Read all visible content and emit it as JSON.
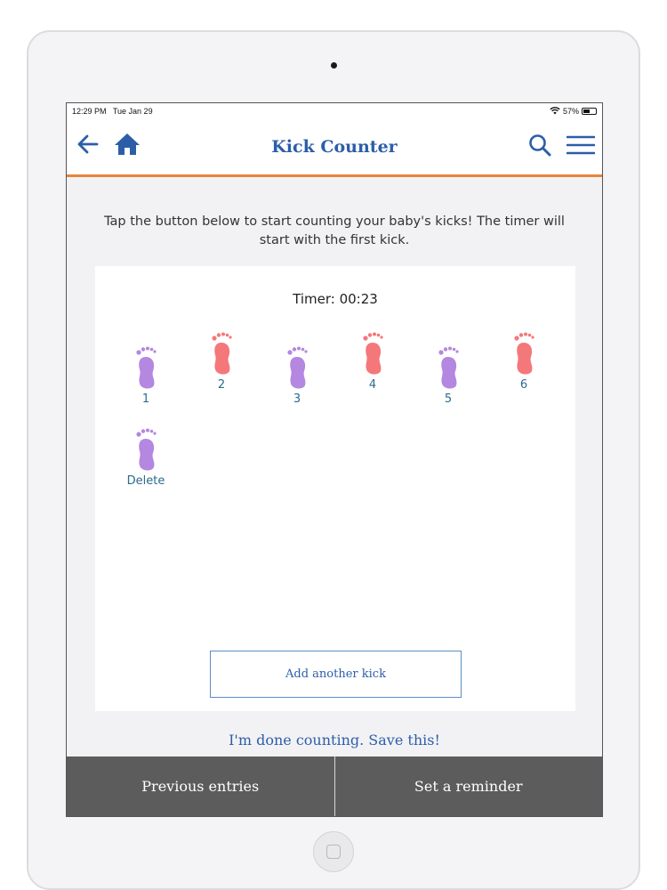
{
  "status_bar": {
    "time": "12:29 PM",
    "date": "Tue Jan 29",
    "battery": "57%",
    "battery_level": 0.57
  },
  "header": {
    "title": "Kick Counter",
    "back_icon": "arrow-left-icon",
    "home_icon": "home-icon",
    "search_icon": "search-icon",
    "menu_icon": "hamburger-menu-icon"
  },
  "intro_text": "Tap the button below to start counting your baby's kicks! The timer will start with the first kick.",
  "timer_text": "Timer: 00:23",
  "kicks": [
    {
      "label": "1",
      "color": "#b487e0"
    },
    {
      "label": "2",
      "color": "#f4787a"
    },
    {
      "label": "3",
      "color": "#b487e0"
    },
    {
      "label": "4",
      "color": "#f4787a"
    },
    {
      "label": "5",
      "color": "#b487e0"
    },
    {
      "label": "6",
      "color": "#f4787a"
    },
    {
      "label": "Delete",
      "color": "#b487e0"
    }
  ],
  "add_kick_label": "Add another kick",
  "done_label": "I'm done counting. Save this!",
  "tabs": [
    {
      "label": "Previous entries"
    },
    {
      "label": "Set a reminder"
    }
  ],
  "colors": {
    "brand_blue": "#2c5ea8",
    "accent_orange": "#e8843a",
    "tab_gray": "#5c5c5c"
  }
}
